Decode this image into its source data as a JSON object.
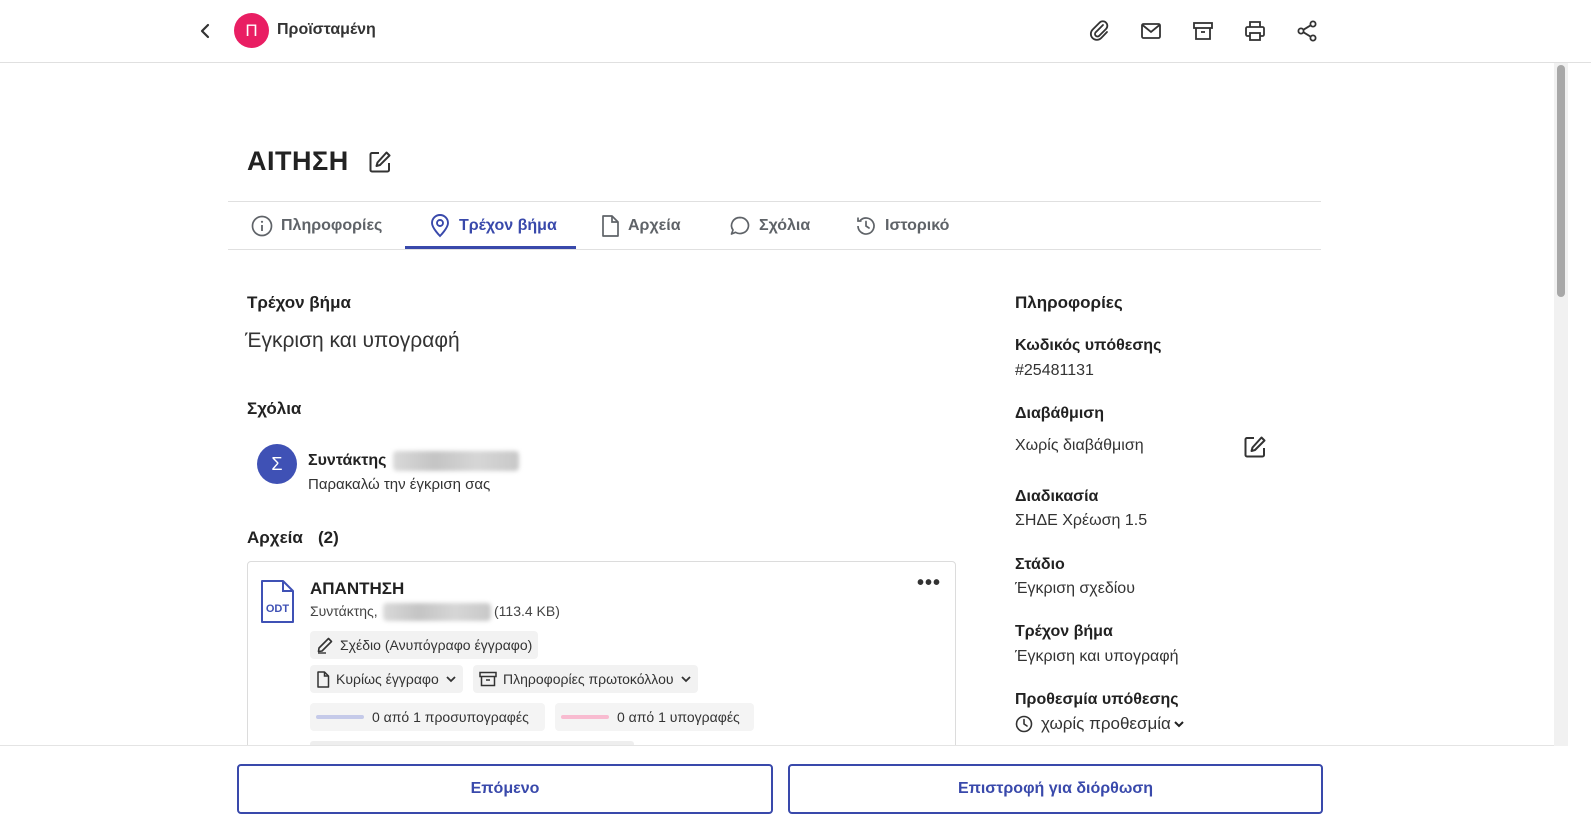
{
  "topbar": {
    "user_initial": "Π",
    "user_name": "Προϊσταμένη",
    "avatar_color": "#e91e63",
    "actions": [
      "attach-icon",
      "mail-icon",
      "archive-icon",
      "print-icon",
      "share-icon"
    ]
  },
  "page": {
    "title": "ΑΙΤΗΣΗ"
  },
  "tabs": [
    {
      "label": "Πληροφορίες",
      "icon": "info-icon"
    },
    {
      "label": "Τρέχον βήμα",
      "icon": "location-pin-icon",
      "active": true
    },
    {
      "label": "Αρχεία",
      "icon": "file-icon"
    },
    {
      "label": "Σχόλια",
      "icon": "comment-icon"
    },
    {
      "label": "Ιστορικό",
      "icon": "history-icon"
    }
  ],
  "current_step": {
    "heading": "Τρέχον βήμα",
    "value": "Έγκριση και υπογραφή"
  },
  "comments": {
    "heading": "Σχόλια",
    "items": [
      {
        "initial": "Σ",
        "author": "Συντάκτης",
        "text": "Παρακαλώ την έγκριση σας",
        "avatar_color": "#3f51b5"
      }
    ]
  },
  "files": {
    "heading": "Αρχεία",
    "count": "(2)",
    "items": [
      {
        "type": "ODT",
        "name": "ΑΠΑΝΤΗΣΗ",
        "author": "Συντάκτης,",
        "size": "(113.4 KB)",
        "status_label": "Σχέδιο (Ανυπόγραφο έγγραφο)",
        "main_doc_label": "Κυρίως έγγραφο",
        "protocol_label": "Πληροφορίες πρωτοκόλλου",
        "cosign_label": "0 από 1 προσυπογραφές",
        "sign_label": "0 από 1 υπογραφές",
        "cosign_color": "#c5cae9",
        "sign_color": "#f8bbd0"
      }
    ]
  },
  "info": {
    "heading": "Πληροφορίες",
    "case_code_label": "Κωδικός υπόθεσης",
    "case_code_value": "#25481131",
    "rating_label": "Διαβάθμιση",
    "rating_value": "Χωρίς διαβάθμιση",
    "process_label": "Διαδικασία",
    "process_value": "ΣΗΔΕ Χρέωση 1.5",
    "stage_label": "Στάδιο",
    "stage_value": "Έγκριση σχεδίου",
    "current_step_label": "Τρέχον βήμα",
    "current_step_value": "Έγκριση και υπογραφή",
    "deadline_label": "Προθεσμία υπόθεσης",
    "deadline_value": "χωρίς προθεσμία"
  },
  "footer": {
    "next_label": "Επόμενο",
    "return_label": "Επιστροφή για διόρθωση",
    "accent_color": "#3949ab"
  }
}
